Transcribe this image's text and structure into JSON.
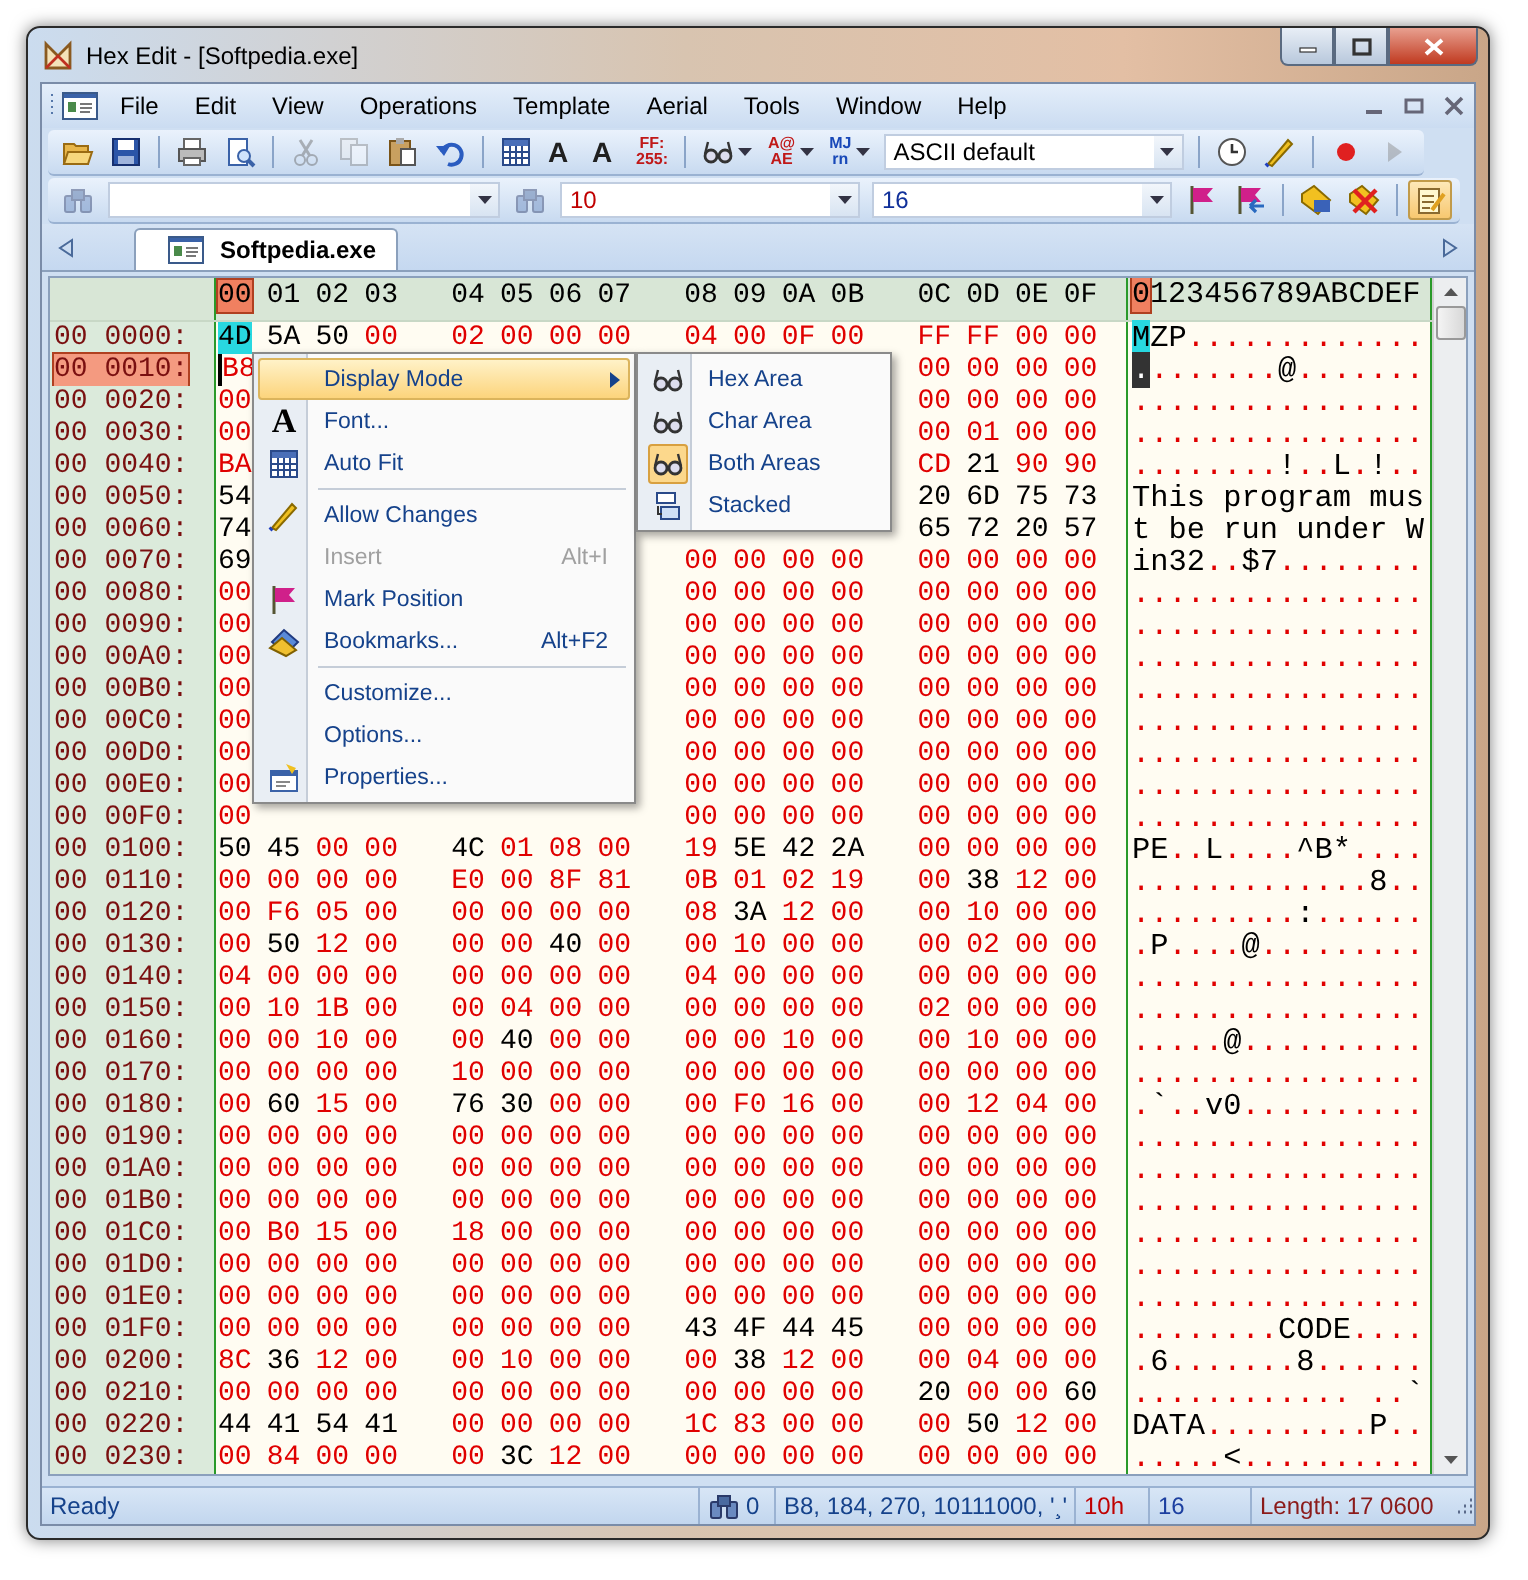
{
  "window": {
    "title": "Hex Edit - [Softpedia.exe]"
  },
  "menu_bar": [
    "File",
    "Edit",
    "View",
    "Operations",
    "Template",
    "Aerial",
    "Tools",
    "Window",
    "Help"
  ],
  "toolbar_1": [
    {
      "kind": "icon",
      "disabled": false,
      "dropdown": false
    },
    {
      "kind": "icon",
      "disabled": false,
      "dropdown": false
    },
    {
      "kind": "sep"
    },
    {
      "kind": "icon",
      "disabled": false,
      "dropdown": false
    },
    {
      "kind": "icon",
      "disabled": false,
      "dropdown": false
    },
    {
      "kind": "sep"
    },
    {
      "kind": "icon",
      "disabled": true,
      "dropdown": false
    },
    {
      "kind": "icon",
      "disabled": true,
      "dropdown": false
    },
    {
      "kind": "icon",
      "disabled": false,
      "dropdown": false
    },
    {
      "kind": "icon",
      "disabled": false,
      "dropdown": false
    },
    {
      "kind": "sep"
    },
    {
      "kind": "icon",
      "disabled": false,
      "dropdown": false
    },
    {
      "kind": "glyph",
      "lines": [
        "A"
      ],
      "color": "#202020",
      "dropdown": false
    },
    {
      "kind": "glyph",
      "lines": [
        "A"
      ],
      "color": "#202020",
      "dropdown": false
    },
    {
      "kind": "glyph",
      "lines": [
        "FF:",
        "255:"
      ],
      "color": "#c01818",
      "dropdown": false
    },
    {
      "kind": "sep"
    },
    {
      "kind": "icon",
      "disabled": false,
      "dropdown": true
    },
    {
      "kind": "glyph",
      "lines": [
        "A@",
        "AE"
      ],
      "color": "#c01818",
      "dropdown": true
    },
    {
      "kind": "glyph",
      "lines": [
        "MJ",
        "rn"
      ],
      "color": "#1848b8",
      "dropdown": true
    },
    {
      "kind": "combo",
      "value": "ASCII default",
      "color": "#000000"
    },
    {
      "kind": "sep"
    },
    {
      "kind": "icon",
      "disabled": false,
      "dropdown": false
    },
    {
      "kind": "icon",
      "disabled": false,
      "dropdown": false
    },
    {
      "kind": "sep"
    },
    {
      "kind": "icon",
      "disabled": false,
      "dropdown": false
    },
    {
      "kind": "icon",
      "disabled": true,
      "dropdown": false
    }
  ],
  "toolbar_2": [
    {
      "kind": "icon",
      "disabled": true
    },
    {
      "kind": "combo"
    },
    {
      "kind": "icon",
      "disabled": true
    },
    {
      "kind": "combo",
      "value": "10",
      "color": "#c00000"
    },
    {
      "kind": "combo",
      "value": "16",
      "color": "#10309a"
    },
    {
      "kind": "icon",
      "disabled": false
    },
    {
      "kind": "icon",
      "disabled": false
    },
    {
      "kind": "sep"
    },
    {
      "kind": "icon",
      "disabled": false
    },
    {
      "kind": "icon",
      "disabled": false
    },
    {
      "kind": "sep"
    },
    {
      "kind": "icon",
      "disabled": false,
      "pressed": true
    }
  ],
  "tabs": [
    {
      "label": "Softpedia.exe",
      "selected": true
    }
  ],
  "hex_view": {
    "columns": [
      {
        "label": "00",
        "selected": true
      },
      {
        "label": "01",
        "selected": false
      },
      {
        "label": "02",
        "selected": false
      },
      {
        "label": "03",
        "selected": false
      },
      {
        "label": "04",
        "selected": false
      },
      {
        "label": "05",
        "selected": false
      },
      {
        "label": "06",
        "selected": false
      },
      {
        "label": "07",
        "selected": false
      },
      {
        "label": "08",
        "selected": false
      },
      {
        "label": "09",
        "selected": false
      },
      {
        "label": "0A",
        "selected": false
      },
      {
        "label": "0B",
        "selected": false
      },
      {
        "label": "0C",
        "selected": false
      },
      {
        "label": "0D",
        "selected": false
      },
      {
        "label": "0E",
        "selected": false
      },
      {
        "label": "0F",
        "selected": false
      }
    ],
    "char_header": {
      "text": "0123456789ABCDEF",
      "first_selected": true
    },
    "rows": [
      {
        "kind": "full",
        "offset": "00 0000:",
        "bytes": [
          "4D",
          "5A",
          "50",
          "00",
          "02",
          "00",
          "00",
          "00",
          "04",
          "00",
          "0F",
          "00",
          "FF",
          "FF",
          "00",
          "00"
        ],
        "chars": "MZP.............",
        "selected": false,
        "byte_selected": true
      },
      {
        "kind": "under_menu_and_submenu",
        "offset": "00 0010:",
        "bytes": [
          "B8",
          "00",
          "00",
          "00",
          "00"
        ],
        "chars": "........@.......",
        "selected": true,
        "byte_selected": false
      },
      {
        "kind": "under_menu_and_submenu",
        "offset": "00 0020:",
        "bytes": [
          "00",
          "00",
          "00",
          "00",
          "00"
        ],
        "chars": "................",
        "selected": false,
        "byte_selected": false
      },
      {
        "kind": "under_menu_and_submenu",
        "offset": "00 0030:",
        "bytes": [
          "00",
          "00",
          "01",
          "00",
          "00"
        ],
        "chars": "................",
        "selected": false,
        "byte_selected": false
      },
      {
        "kind": "under_menu_and_submenu",
        "offset": "00 0040:",
        "bytes": [
          "BA",
          "CD",
          "21",
          "90",
          "90"
        ],
        "chars": "........!..L.!..",
        "selected": false,
        "byte_selected": false
      },
      {
        "kind": "under_menu_and_submenu",
        "offset": "00 0050:",
        "bytes": [
          "54",
          "20",
          "6D",
          "75",
          "73"
        ],
        "chars": "This program mus",
        "selected": false,
        "byte_selected": false
      },
      {
        "kind": "under_menu_and_submenu",
        "offset": "00 0060:",
        "bytes": [
          "74",
          "65",
          "72",
          "20",
          "57"
        ],
        "chars": "t be run under W",
        "selected": false,
        "byte_selected": false
      },
      {
        "kind": "under_menu",
        "offset": "00 0070:",
        "bytes": [
          "69",
          "00",
          "00",
          "00",
          "00",
          "00",
          "00",
          "00",
          "00"
        ],
        "chars": "in32..$7........",
        "selected": false,
        "byte_selected": false
      },
      {
        "kind": "under_menu",
        "offset": "00 0080:",
        "bytes": [
          "00",
          "00",
          "00",
          "00",
          "00",
          "00",
          "00",
          "00",
          "00"
        ],
        "chars": "................",
        "selected": false,
        "byte_selected": false
      },
      {
        "kind": "under_menu",
        "offset": "00 0090:",
        "bytes": [
          "00",
          "00",
          "00",
          "00",
          "00",
          "00",
          "00",
          "00",
          "00"
        ],
        "chars": "................",
        "selected": false,
        "byte_selected": false
      },
      {
        "kind": "under_menu",
        "offset": "00 00A0:",
        "bytes": [
          "00",
          "00",
          "00",
          "00",
          "00",
          "00",
          "00",
          "00",
          "00"
        ],
        "chars": "................",
        "selected": false,
        "byte_selected": false
      },
      {
        "kind": "under_menu",
        "offset": "00 00B0:",
        "bytes": [
          "00",
          "00",
          "00",
          "00",
          "00",
          "00",
          "00",
          "00",
          "00"
        ],
        "chars": "................",
        "selected": false,
        "byte_selected": false
      },
      {
        "kind": "under_menu",
        "offset": "00 00C0:",
        "bytes": [
          "00",
          "00",
          "00",
          "00",
          "00",
          "00",
          "00",
          "00",
          "00"
        ],
        "chars": "................",
        "selected": false,
        "byte_selected": false
      },
      {
        "kind": "under_menu",
        "offset": "00 00D0:",
        "bytes": [
          "00",
          "00",
          "00",
          "00",
          "00",
          "00",
          "00",
          "00",
          "00"
        ],
        "chars": "................",
        "selected": false,
        "byte_selected": false
      },
      {
        "kind": "under_menu",
        "offset": "00 00E0:",
        "bytes": [
          "00",
          "00",
          "00",
          "00",
          "00",
          "00",
          "00",
          "00",
          "00"
        ],
        "chars": "................",
        "selected": false,
        "byte_selected": false
      },
      {
        "kind": "under_menu",
        "offset": "00 00F0:",
        "bytes": [
          "00",
          "00",
          "00",
          "00",
          "00",
          "00",
          "00",
          "00",
          "00"
        ],
        "chars": "................",
        "selected": false,
        "byte_selected": false
      },
      {
        "kind": "full",
        "offset": "00 0100:",
        "bytes": [
          "50",
          "45",
          "00",
          "00",
          "4C",
          "01",
          "08",
          "00",
          "19",
          "5E",
          "42",
          "2A",
          "00",
          "00",
          "00",
          "00"
        ],
        "chars": "PE..L....^B*....",
        "selected": false,
        "byte_selected": false
      },
      {
        "kind": "full",
        "offset": "00 0110:",
        "bytes": [
          "00",
          "00",
          "00",
          "00",
          "E0",
          "00",
          "8F",
          "81",
          "0B",
          "01",
          "02",
          "19",
          "00",
          "38",
          "12",
          "00"
        ],
        "chars": ".............8..",
        "selected": false,
        "byte_selected": false
      },
      {
        "kind": "full",
        "offset": "00 0120:",
        "bytes": [
          "00",
          "F6",
          "05",
          "00",
          "00",
          "00",
          "00",
          "00",
          "08",
          "3A",
          "12",
          "00",
          "00",
          "10",
          "00",
          "00"
        ],
        "chars": ".........:......",
        "selected": false,
        "byte_selected": false
      },
      {
        "kind": "full",
        "offset": "00 0130:",
        "bytes": [
          "00",
          "50",
          "12",
          "00",
          "00",
          "00",
          "40",
          "00",
          "00",
          "10",
          "00",
          "00",
          "00",
          "02",
          "00",
          "00"
        ],
        "chars": ".P....@.........",
        "selected": false,
        "byte_selected": false
      },
      {
        "kind": "full",
        "offset": "00 0140:",
        "bytes": [
          "04",
          "00",
          "00",
          "00",
          "00",
          "00",
          "00",
          "00",
          "04",
          "00",
          "00",
          "00",
          "00",
          "00",
          "00",
          "00"
        ],
        "chars": "................",
        "selected": false,
        "byte_selected": false
      },
      {
        "kind": "full",
        "offset": "00 0150:",
        "bytes": [
          "00",
          "10",
          "1B",
          "00",
          "00",
          "04",
          "00",
          "00",
          "00",
          "00",
          "00",
          "00",
          "02",
          "00",
          "00",
          "00"
        ],
        "chars": "................",
        "selected": false,
        "byte_selected": false
      },
      {
        "kind": "full",
        "offset": "00 0160:",
        "bytes": [
          "00",
          "00",
          "10",
          "00",
          "00",
          "40",
          "00",
          "00",
          "00",
          "00",
          "10",
          "00",
          "00",
          "10",
          "00",
          "00"
        ],
        "chars": ".....@..........",
        "selected": false,
        "byte_selected": false
      },
      {
        "kind": "full",
        "offset": "00 0170:",
        "bytes": [
          "00",
          "00",
          "00",
          "00",
          "10",
          "00",
          "00",
          "00",
          "00",
          "00",
          "00",
          "00",
          "00",
          "00",
          "00",
          "00"
        ],
        "chars": "................",
        "selected": false,
        "byte_selected": false
      },
      {
        "kind": "full",
        "offset": "00 0180:",
        "bytes": [
          "00",
          "60",
          "15",
          "00",
          "76",
          "30",
          "00",
          "00",
          "00",
          "F0",
          "16",
          "00",
          "00",
          "12",
          "04",
          "00"
        ],
        "chars": ".`..v0..........",
        "selected": false,
        "byte_selected": false
      },
      {
        "kind": "full",
        "offset": "00 0190:",
        "bytes": [
          "00",
          "00",
          "00",
          "00",
          "00",
          "00",
          "00",
          "00",
          "00",
          "00",
          "00",
          "00",
          "00",
          "00",
          "00",
          "00"
        ],
        "chars": "................",
        "selected": false,
        "byte_selected": false
      },
      {
        "kind": "full",
        "offset": "00 01A0:",
        "bytes": [
          "00",
          "00",
          "00",
          "00",
          "00",
          "00",
          "00",
          "00",
          "00",
          "00",
          "00",
          "00",
          "00",
          "00",
          "00",
          "00"
        ],
        "chars": "................",
        "selected": false,
        "byte_selected": false
      },
      {
        "kind": "full",
        "offset": "00 01B0:",
        "bytes": [
          "00",
          "00",
          "00",
          "00",
          "00",
          "00",
          "00",
          "00",
          "00",
          "00",
          "00",
          "00",
          "00",
          "00",
          "00",
          "00"
        ],
        "chars": "................",
        "selected": false,
        "byte_selected": false
      },
      {
        "kind": "full",
        "offset": "00 01C0:",
        "bytes": [
          "00",
          "B0",
          "15",
          "00",
          "18",
          "00",
          "00",
          "00",
          "00",
          "00",
          "00",
          "00",
          "00",
          "00",
          "00",
          "00"
        ],
        "chars": "................",
        "selected": false,
        "byte_selected": false
      },
      {
        "kind": "full",
        "offset": "00 01D0:",
        "bytes": [
          "00",
          "00",
          "00",
          "00",
          "00",
          "00",
          "00",
          "00",
          "00",
          "00",
          "00",
          "00",
          "00",
          "00",
          "00",
          "00"
        ],
        "chars": "................",
        "selected": false,
        "byte_selected": false
      },
      {
        "kind": "full",
        "offset": "00 01E0:",
        "bytes": [
          "00",
          "00",
          "00",
          "00",
          "00",
          "00",
          "00",
          "00",
          "00",
          "00",
          "00",
          "00",
          "00",
          "00",
          "00",
          "00"
        ],
        "chars": "................",
        "selected": false,
        "byte_selected": false
      },
      {
        "kind": "full",
        "offset": "00 01F0:",
        "bytes": [
          "00",
          "00",
          "00",
          "00",
          "00",
          "00",
          "00",
          "00",
          "43",
          "4F",
          "44",
          "45",
          "00",
          "00",
          "00",
          "00"
        ],
        "chars": "........CODE....",
        "selected": false,
        "byte_selected": false
      },
      {
        "kind": "full",
        "offset": "00 0200:",
        "bytes": [
          "8C",
          "36",
          "12",
          "00",
          "00",
          "10",
          "00",
          "00",
          "00",
          "38",
          "12",
          "00",
          "00",
          "04",
          "00",
          "00"
        ],
        "chars": ".6.......8......",
        "selected": false,
        "byte_selected": false
      },
      {
        "kind": "full",
        "offset": "00 0210:",
        "bytes": [
          "00",
          "00",
          "00",
          "00",
          "00",
          "00",
          "00",
          "00",
          "00",
          "00",
          "00",
          "00",
          "20",
          "00",
          "00",
          "60"
        ],
        "chars": "............ ..`",
        "selected": false,
        "byte_selected": false
      },
      {
        "kind": "full",
        "offset": "00 0220:",
        "bytes": [
          "44",
          "41",
          "54",
          "41",
          "00",
          "00",
          "00",
          "00",
          "1C",
          "83",
          "00",
          "00",
          "00",
          "50",
          "12",
          "00"
        ],
        "chars": "DATA.........P..",
        "selected": false,
        "byte_selected": false
      },
      {
        "kind": "full",
        "offset": "00 0230:",
        "bytes": [
          "00",
          "84",
          "00",
          "00",
          "00",
          "3C",
          "12",
          "00",
          "00",
          "00",
          "00",
          "00",
          "00",
          "00",
          "00",
          "00"
        ],
        "chars": ".....<..........",
        "selected": false,
        "byte_selected": false
      }
    ]
  },
  "context_menu": [
    {
      "kind": "item",
      "label": "Display Mode",
      "selected": true,
      "disabled": false,
      "submenu": true
    },
    {
      "kind": "item",
      "label": "Font...",
      "glyph": "A",
      "selected": false,
      "disabled": false,
      "submenu": false
    },
    {
      "kind": "item",
      "label": "Auto Fit",
      "selected": false,
      "disabled": false,
      "submenu": false
    },
    {
      "kind": "separator"
    },
    {
      "kind": "item",
      "label": "Allow Changes",
      "selected": false,
      "disabled": false,
      "submenu": false
    },
    {
      "kind": "item",
      "label": "Insert",
      "shortcut": "Alt+I",
      "selected": false,
      "disabled": true,
      "submenu": false
    },
    {
      "kind": "item",
      "label": "Mark Position",
      "selected": false,
      "disabled": false,
      "submenu": false
    },
    {
      "kind": "item",
      "label": "Bookmarks...",
      "shortcut": "Alt+F2",
      "selected": false,
      "disabled": false,
      "submenu": false
    },
    {
      "kind": "separator"
    },
    {
      "kind": "item",
      "label": "Customize...",
      "selected": false,
      "disabled": false,
      "submenu": false
    },
    {
      "kind": "item",
      "label": "Options...",
      "selected": false,
      "disabled": false,
      "submenu": false
    },
    {
      "kind": "item",
      "label": "Properties...",
      "selected": false,
      "disabled": false,
      "submenu": false
    }
  ],
  "submenu": [
    {
      "label": "Hex Area",
      "checked": false
    },
    {
      "label": "Char Area",
      "checked": false
    },
    {
      "label": "Both Areas",
      "checked": true
    },
    {
      "label": "Stacked",
      "checked": false
    }
  ],
  "status_bar": [
    {
      "text": "Ready",
      "color": "#15428b"
    },
    {
      "text": "0",
      "color": "#15428b"
    },
    {
      "text": "B8, 184, 270, 10111000, '¸'",
      "color": "#15428b"
    },
    {
      "text": "10h",
      "color": "#c00000"
    },
    {
      "text": "16",
      "color": "#1c3fa0"
    },
    {
      "text": "Length: 17 0600",
      "color": "#8b1a1a"
    }
  ]
}
